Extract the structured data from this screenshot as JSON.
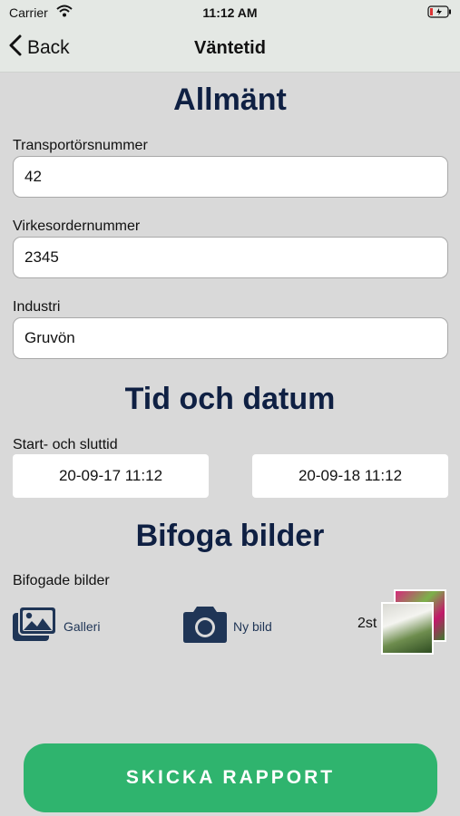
{
  "status_bar": {
    "carrier": "Carrier",
    "time": "11:12 AM"
  },
  "nav": {
    "back_label": "Back",
    "title": "Väntetid"
  },
  "sections": {
    "general": "Allmänt",
    "time_date": "Tid och datum",
    "attach": "Bifoga bilder"
  },
  "fields": {
    "transporter_label": "Transportörsnummer",
    "transporter_value": "42",
    "order_label": "Virkesordernummer",
    "order_value": "2345",
    "industry_label": "Industri",
    "industry_value": "Gruvön"
  },
  "time": {
    "label": "Start- och sluttid",
    "start": "20-09-17 11:12",
    "end": "20-09-18 11:12"
  },
  "attachments": {
    "label": "Bifogade bilder",
    "gallery": "Galleri",
    "new_photo": "Ny bild",
    "count": "2st"
  },
  "submit_label": "SKICKA RAPPORT",
  "colors": {
    "heading": "#0f2043",
    "accent": "#2fb46e",
    "icon": "#1f3556"
  }
}
